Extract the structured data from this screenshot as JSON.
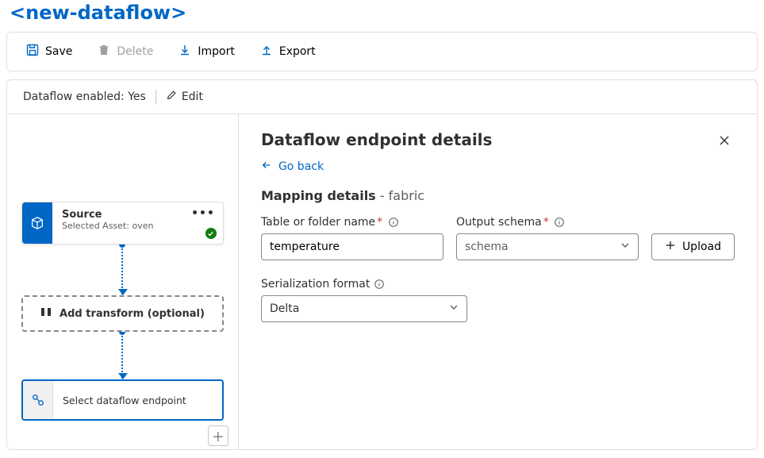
{
  "title": "<new-dataflow>",
  "toolbar": {
    "save": "Save",
    "delete": "Delete",
    "import": "Import",
    "export": "Export"
  },
  "canvas": {
    "status_text": "Dataflow enabled: Yes",
    "edit": "Edit"
  },
  "nodes": {
    "source": {
      "title": "Source",
      "subtitle": "Selected Asset: oven"
    },
    "transform": {
      "label": "Add transform (optional)"
    },
    "destination": {
      "label": "Select dataflow endpoint"
    }
  },
  "panel": {
    "title": "Dataflow endpoint details",
    "go_back": "Go back",
    "section": "Mapping details",
    "section_sub": " - fabric",
    "fields": {
      "table": {
        "label": "Table or folder name",
        "value": "temperature"
      },
      "schema": {
        "label": "Output schema",
        "placeholder": "schema"
      },
      "upload": {
        "label": "Upload"
      },
      "format": {
        "label": "Serialization format",
        "value": "Delta"
      }
    }
  }
}
